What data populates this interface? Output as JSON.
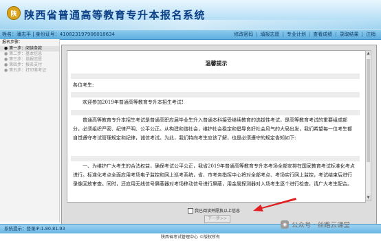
{
  "header": {
    "logo_glyph": "陕",
    "title": "陕西省普通高等教育专升本报名系统"
  },
  "navbar": {
    "user_info": "姓名：潘志平 | 身份证号：410823197906018634",
    "links": [
      "修改密码",
      "填报志愿",
      "专业计划",
      "查看成绩",
      "录取结果",
      "注销"
    ]
  },
  "sidebar": {
    "caption": "报名步骤：",
    "steps": [
      "● 第一步：阅读条款",
      "● 第二步：基本信息",
      "● 第三步：填报志愿",
      "● 第四步：报名支付",
      "● 第五步：打印准考证"
    ]
  },
  "notice": {
    "title": "温馨提示",
    "greeting": "各位考生:",
    "welcome": "欢迎参加2019年普通高等教育专升本招生考试!",
    "para1": "普通高等教育专升本招生考试是普通高职应届毕业生升入普通本科接受继续教育的选拔性考试，是高等教育考试的重要组成部分，必须组织严密、纪律严明、公平公正。从构建和谐社会，维护社会稳定和倡导良好社会风气的大局出发，我们希望每一位考生都自觉遵守考试管理规定和纪律，诚信考试。为此，我们特向考生应该了解，也是必须遵守的规定告知如下:",
    "para2": "一、为维护广大考生的合法权益，确保考试公平公正，我省2019年普通高等教育专升本考场全部安排在国家教育考试标准化考点进行。标准化考点全面应用考场电子监控和网上巡考系统，省、市考务指挥中心将对全部考点、考场实行网上监控，考试结束后进行录像回放审查。同时，还应用无线信号屏蔽器对考场移动信号进行屏蔽，用金属探测器对入场考生逐个进行检查，请广大考生配合。"
  },
  "agree_label": "我已阅读并愿执以上信息",
  "next_button": "下一步>>",
  "status": "系统提示：登录IP:1.80.81.93",
  "footer": "陕西省考试管理中心 ©版权所有",
  "watermark": "公众号 · 丝路云课堂",
  "colors": {
    "title": "#0b3f86",
    "annotation_arrow": "#e02020"
  },
  "icons": [
    "logo-emblem-icon",
    "wechat-icon",
    "arrow-annotation"
  ]
}
